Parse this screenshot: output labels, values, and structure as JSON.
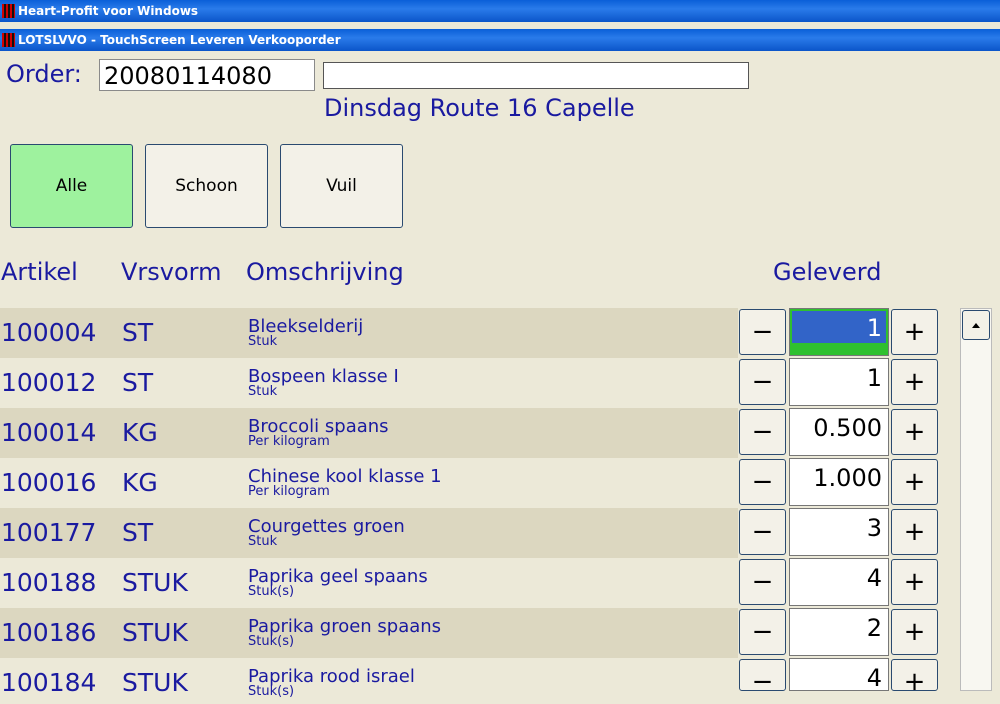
{
  "window": {
    "title": "Heart-Profit voor Windows",
    "subtitle": "LOTSLVVO - TouchScreen Leveren Verkooporder"
  },
  "order": {
    "label": "Order:",
    "number": "20080114080",
    "name": "",
    "route": "Dinsdag Route 16 Capelle"
  },
  "filters": {
    "all": "Alle",
    "clean": "Schoon",
    "dirty": "Vuil"
  },
  "columns": {
    "artikel": "Artikel",
    "vrsvorm": "Vrsvorm",
    "omschrijving": "Omschrijving",
    "geleverd": "Geleverd"
  },
  "controls": {
    "minus": "−",
    "plus": "+"
  },
  "rows": [
    {
      "artikel": "100004",
      "vrsvorm": "ST",
      "desc": "Bleekselderij",
      "unit": "Stuk",
      "qty": "1"
    },
    {
      "artikel": "100012",
      "vrsvorm": "ST",
      "desc": "Bospeen klasse I",
      "unit": "Stuk",
      "qty": "1"
    },
    {
      "artikel": "100014",
      "vrsvorm": "KG",
      "desc": "Broccoli spaans",
      "unit": "Per kilogram",
      "qty": "0.500"
    },
    {
      "artikel": "100016",
      "vrsvorm": "KG",
      "desc": "Chinese kool klasse 1",
      "unit": "Per kilogram",
      "qty": "1.000"
    },
    {
      "artikel": "100177",
      "vrsvorm": "ST",
      "desc": "Courgettes groen",
      "unit": "Stuk",
      "qty": "3"
    },
    {
      "artikel": "100188",
      "vrsvorm": "STUK",
      "desc": "Paprika geel spaans",
      "unit": "Stuk(s)",
      "qty": "4"
    },
    {
      "artikel": "100186",
      "vrsvorm": "STUK",
      "desc": "Paprika groen spaans",
      "unit": "Stuk(s)",
      "qty": "2"
    },
    {
      "artikel": "100184",
      "vrsvorm": "STUK",
      "desc": "Paprika rood israel",
      "unit": "Stuk(s)",
      "qty": "4"
    }
  ]
}
